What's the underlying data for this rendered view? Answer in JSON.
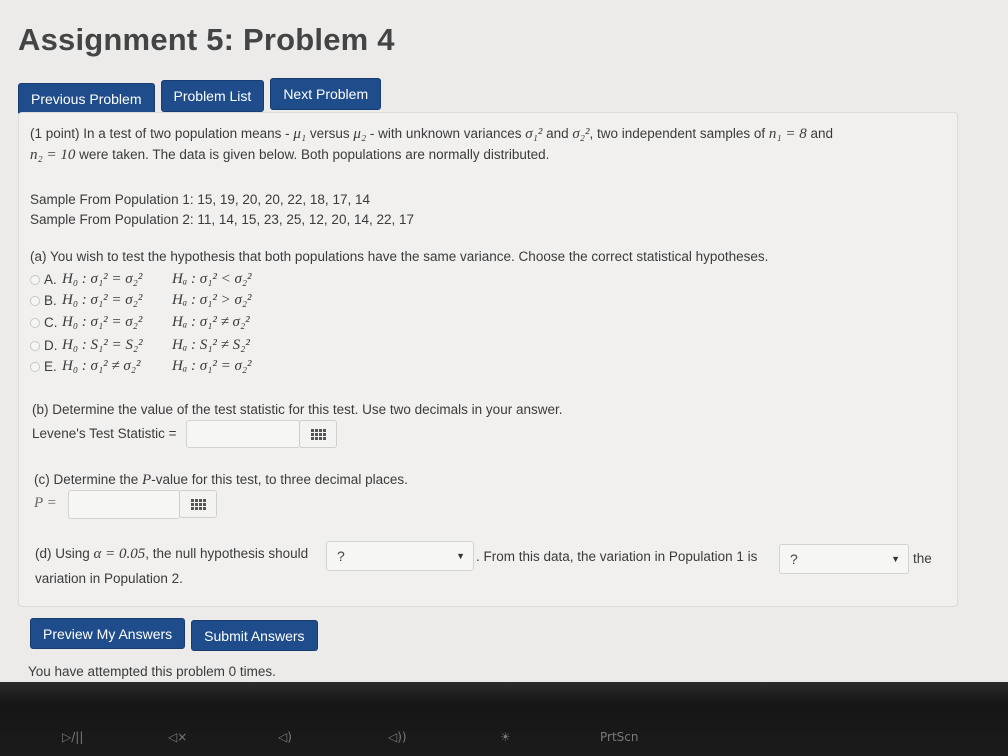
{
  "title": "Assignment 5: Problem 4",
  "nav": {
    "previous": "Previous Problem",
    "list": "Problem List",
    "next": "Next Problem"
  },
  "intro": {
    "line1_a": "(1 point) In a test of two population means - ",
    "mu1": "μ₁",
    "versus": " versus ",
    "mu2": "μ₂",
    "line1_b": " - with unknown variances ",
    "sigma1sq": "σ₁²",
    "and": " and ",
    "sigma2sq": "σ₂²",
    "line1_c": ", two independent samples of ",
    "n1": "n₁ = 8",
    "and2": " and",
    "n2": "n₂ = 10",
    "line2": " were taken. The data is given below. Both populations are normally distributed."
  },
  "samples": {
    "pop1": "Sample From Population 1: 15, 19, 20, 20, 22, 18, 17, 14",
    "pop2": "Sample From Population 2: 11, 14, 15, 23, 25, 12, 20, 14, 22, 17"
  },
  "part_a": {
    "question": "(a) You wish to test the hypothesis that both populations have the same variance. Choose the correct statistical hypotheses.",
    "options": [
      {
        "letter": "A.",
        "h0": "H₀ : σ₁² = σ₂²",
        "ha": "Hₐ : σ₁² < σ₂²"
      },
      {
        "letter": "B.",
        "h0": "H₀ : σ₁² = σ₂²",
        "ha": "Hₐ : σ₁² > σ₂²"
      },
      {
        "letter": "C.",
        "h0": "H₀ : σ₁² = σ₂²",
        "ha": "Hₐ : σ₁² ≠ σ₂²"
      },
      {
        "letter": "D.",
        "h0": "H₀ : S₁² = S₂²",
        "ha": "Hₐ : S₁² ≠ S₂²"
      },
      {
        "letter": "E.",
        "h0": "H₀ : σ₁² ≠ σ₂²",
        "ha": "Hₐ : σ₁² = σ₂²"
      }
    ]
  },
  "part_b": {
    "question": "(b) Determine the value of the test statistic for this test. Use two decimals in your answer.",
    "label": "Levene's Test Statistic =",
    "value": ""
  },
  "part_c": {
    "question_a": "(c) Determine the ",
    "P": "P",
    "question_b": "-value for this test, to three decimal places.",
    "label": "P =",
    "value": ""
  },
  "part_d": {
    "text_a": "(d) Using ",
    "alpha": "α = 0.05",
    "text_b": ", the null hypothesis should",
    "select1": "?",
    "text_c": ". From this data, the variation in Population 1 is",
    "select2": "?",
    "text_d": "the",
    "text_e": "variation in Population 2."
  },
  "actions": {
    "preview": "Preview My Answers",
    "submit": "Submit Answers"
  },
  "attempts": "You have attempted this problem 0 times.",
  "keys": [
    "▷/||",
    "◁×",
    "◁)",
    "◁))",
    "☀",
    "PrtScn"
  ]
}
